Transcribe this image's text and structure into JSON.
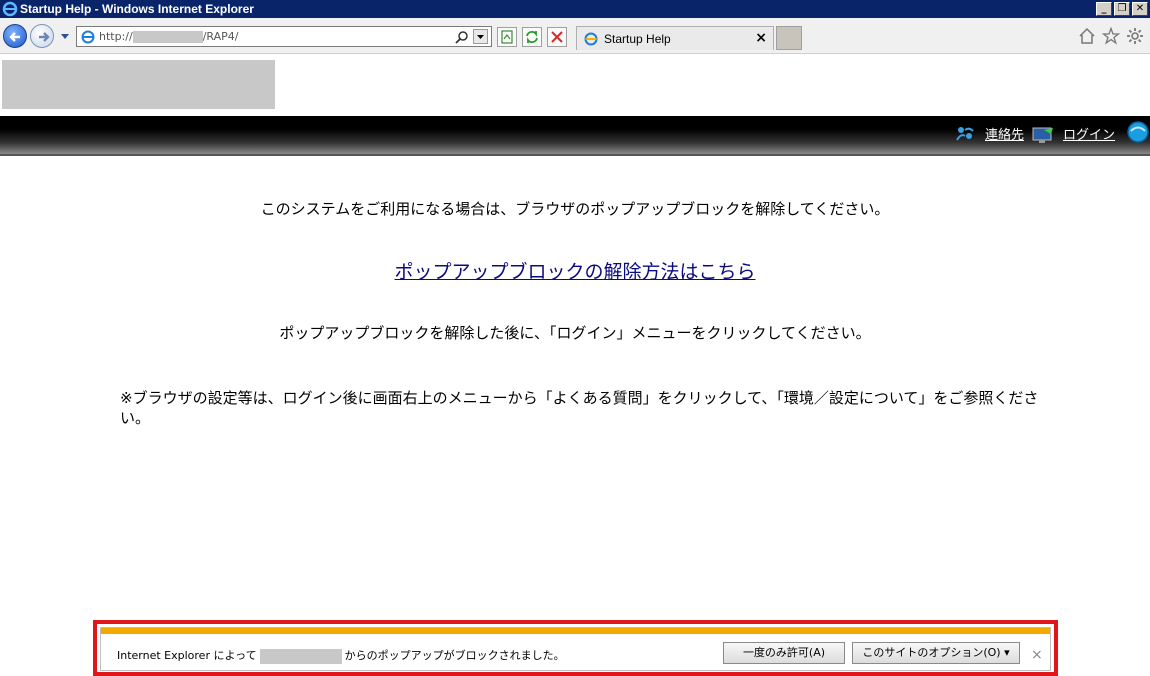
{
  "window": {
    "title": "Startup Help - Windows Internet Explorer",
    "controls": {
      "minimize": "_",
      "maximize": "❐",
      "close": "✕"
    }
  },
  "navbar": {
    "url_prefix": "http://",
    "url_suffix": "/RAP4/",
    "tab_label": "Startup Help",
    "tab_close": "×"
  },
  "header": {
    "contact_label": "連絡先",
    "login_label": "ログイン"
  },
  "content": {
    "message1": "このシステムをご利用になる場合は、ブラウザのポップアップブロックを解除してください。",
    "help_link": "ポップアップブロックの解除方法はこちら",
    "message2": "ポップアップブロックを解除した後に、「ログイン」メニューをクリックしてください。",
    "note": "※ブラウザの設定等は、ログイン後に画面右上のメニューから「よくある質問」をクリックして、「環境／設定について」をご参照ください。"
  },
  "infobar": {
    "text_prefix": "Internet Explorer によって",
    "text_suffix": "からのポップアップがブロックされました。",
    "allow_once": "一度のみ許可(A)",
    "site_options": "このサイトのオプション(O) ▾",
    "close": "×"
  },
  "colors": {
    "highlight": "#e0161b",
    "infobar_stripe": "#f4a800",
    "titlebar": "#0a246a"
  }
}
